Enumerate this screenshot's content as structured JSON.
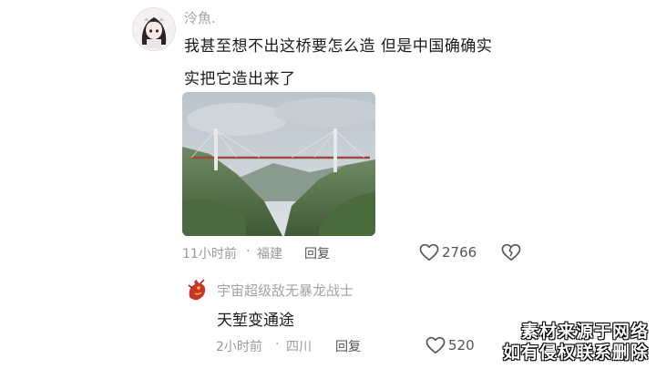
{
  "comment": {
    "username": "泠魚.",
    "text_line1": "我甚至想不出这桥要怎么造 但是中国确确实",
    "text_line2": "实把它造出来了",
    "time": "11小时前",
    "location": "福建",
    "reply_label": "回复",
    "likes": "2766"
  },
  "reply": {
    "username": "宇宙超级敌无暴龙战士",
    "text": "天堑变通途",
    "time": "2小时前",
    "location": "四川",
    "reply_label": "回复",
    "likes": "520"
  },
  "watermark": {
    "line1": "素材来源于网络",
    "line2": "如有侵权联系删除"
  },
  "meta_separator": "·",
  "icons": [
    "heart-icon",
    "broken-heart-icon",
    "dragon-avatar-icon",
    "girl-avatar-icon"
  ]
}
